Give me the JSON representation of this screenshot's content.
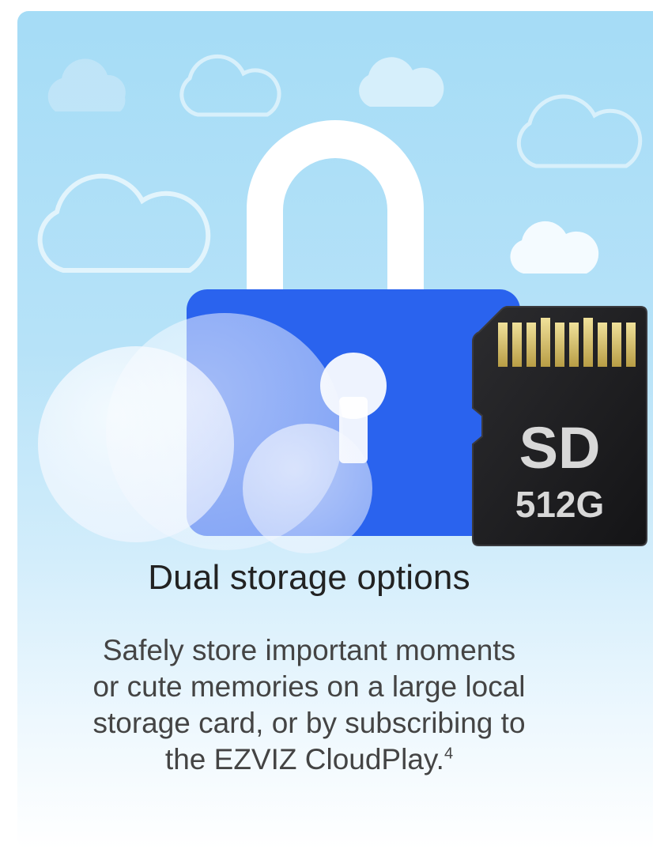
{
  "feature_card": {
    "title": "Dual storage options",
    "description_lines": [
      "Safely store important moments",
      "or cute memories on a large local",
      "storage card, or by subscribing to",
      "the EZVIZ CloudPlay."
    ],
    "footnote": "4",
    "sd_card": {
      "label": "SD",
      "capacity": "512G"
    }
  },
  "colors": {
    "sky_top": "#a5dcf6",
    "lock_body": "#2a63ee",
    "shackle": "#ffffff",
    "sd_card_body": "#1e1e20",
    "sd_contacts": "#d9c46a"
  }
}
